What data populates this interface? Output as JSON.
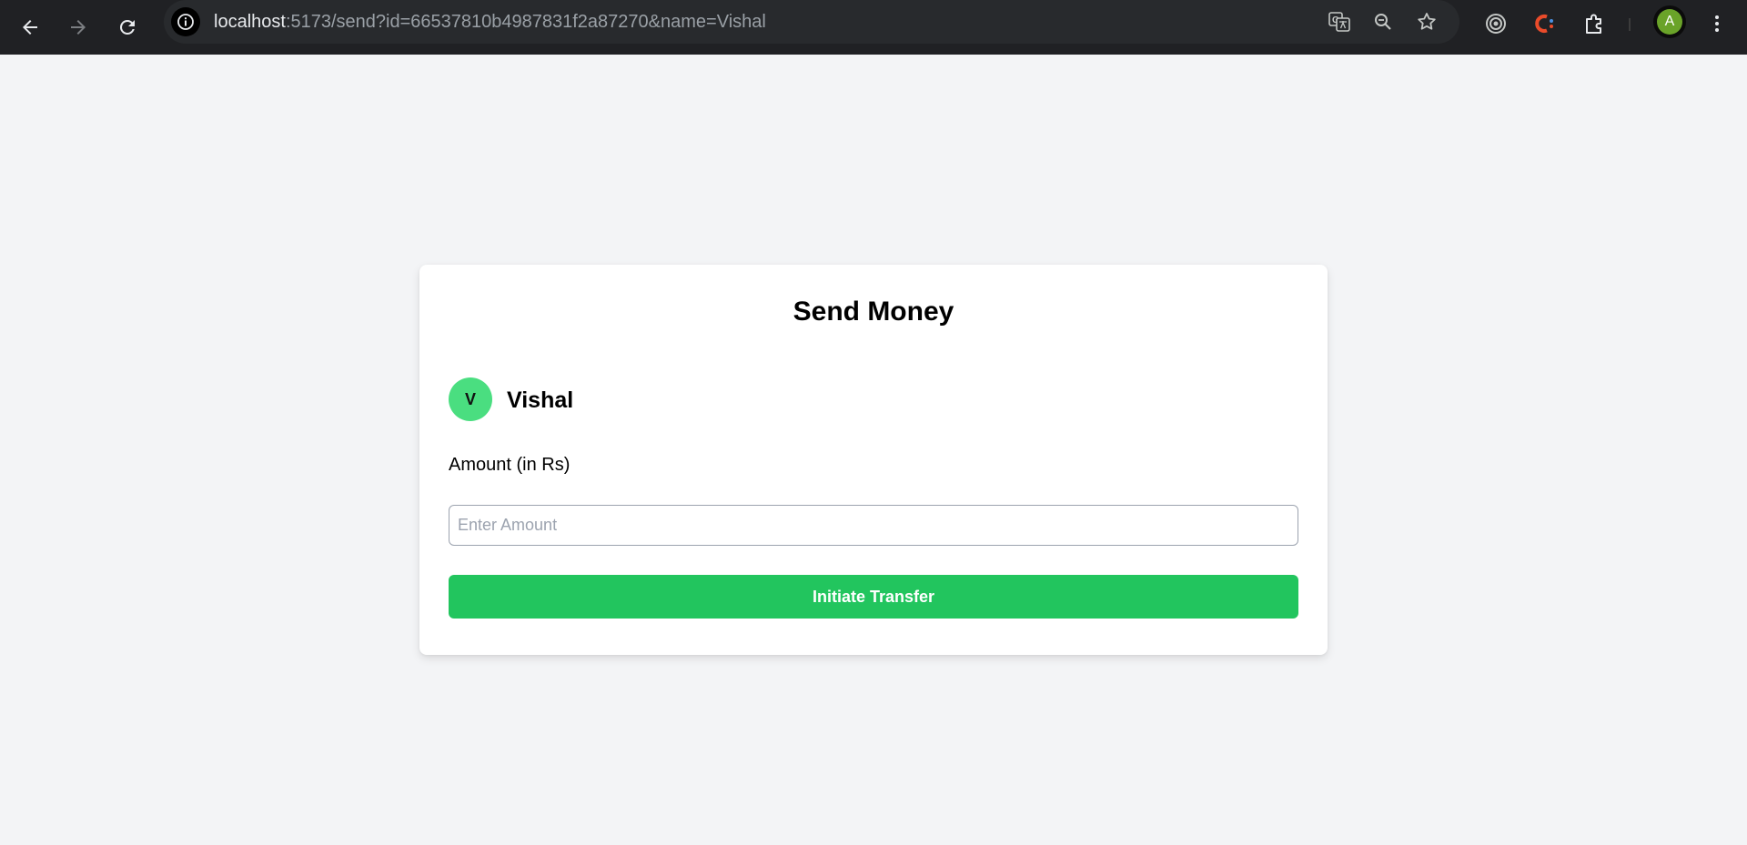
{
  "browser": {
    "url_host": "localhost",
    "url_rest": ":5173/send?id=66537810b4987831f2a87270&name=Vishal",
    "profile_initial": "A",
    "nav": {
      "back_icon": "arrow-left-icon",
      "forward_icon": "arrow-right-icon",
      "reload_icon": "reload-icon"
    },
    "omnibox_icons": [
      "translate-icon",
      "zoom-icon",
      "bookmark-star-icon"
    ],
    "extension_icons": [
      "target-extension-icon",
      "c-extension-icon",
      "puzzle-extensions-icon"
    ],
    "menu_icon": "kebab-menu-icon"
  },
  "page": {
    "title": "Send Money",
    "recipient": {
      "initial": "V",
      "name": "Vishal"
    },
    "amount_label": "Amount (in Rs)",
    "amount_input": {
      "placeholder": "Enter Amount",
      "value": ""
    },
    "submit_label": "Initiate Transfer"
  },
  "colors": {
    "page_background": "#f3f4f6",
    "card_background": "#ffffff",
    "avatar_green": "#4ade80",
    "button_green": "#22c55e",
    "toolbar": "#202124"
  }
}
